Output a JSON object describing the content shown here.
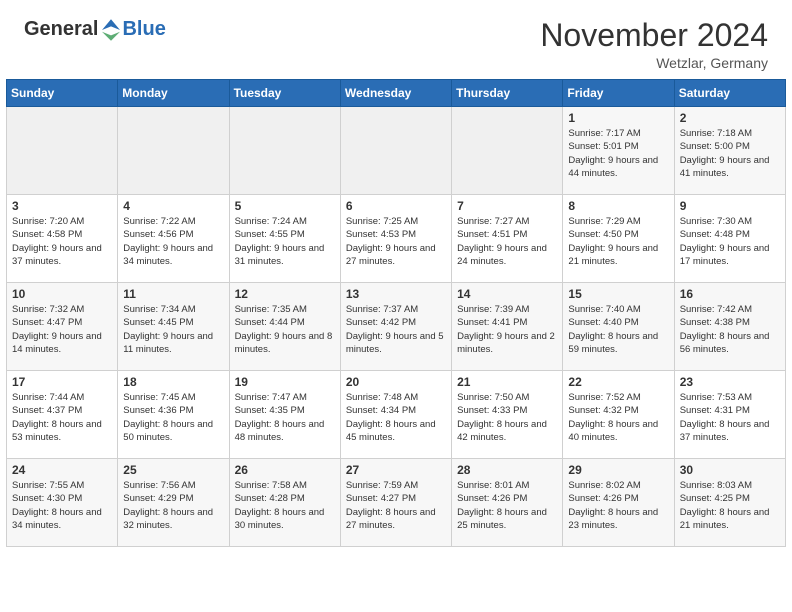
{
  "header": {
    "logo": {
      "general": "General",
      "blue": "Blue"
    },
    "title": "November 2024",
    "location": "Wetzlar, Germany"
  },
  "weekdays": [
    "Sunday",
    "Monday",
    "Tuesday",
    "Wednesday",
    "Thursday",
    "Friday",
    "Saturday"
  ],
  "weeks": [
    [
      {
        "day": "",
        "info": ""
      },
      {
        "day": "",
        "info": ""
      },
      {
        "day": "",
        "info": ""
      },
      {
        "day": "",
        "info": ""
      },
      {
        "day": "",
        "info": ""
      },
      {
        "day": "1",
        "info": "Sunrise: 7:17 AM\nSunset: 5:01 PM\nDaylight: 9 hours and 44 minutes."
      },
      {
        "day": "2",
        "info": "Sunrise: 7:18 AM\nSunset: 5:00 PM\nDaylight: 9 hours and 41 minutes."
      }
    ],
    [
      {
        "day": "3",
        "info": "Sunrise: 7:20 AM\nSunset: 4:58 PM\nDaylight: 9 hours and 37 minutes."
      },
      {
        "day": "4",
        "info": "Sunrise: 7:22 AM\nSunset: 4:56 PM\nDaylight: 9 hours and 34 minutes."
      },
      {
        "day": "5",
        "info": "Sunrise: 7:24 AM\nSunset: 4:55 PM\nDaylight: 9 hours and 31 minutes."
      },
      {
        "day": "6",
        "info": "Sunrise: 7:25 AM\nSunset: 4:53 PM\nDaylight: 9 hours and 27 minutes."
      },
      {
        "day": "7",
        "info": "Sunrise: 7:27 AM\nSunset: 4:51 PM\nDaylight: 9 hours and 24 minutes."
      },
      {
        "day": "8",
        "info": "Sunrise: 7:29 AM\nSunset: 4:50 PM\nDaylight: 9 hours and 21 minutes."
      },
      {
        "day": "9",
        "info": "Sunrise: 7:30 AM\nSunset: 4:48 PM\nDaylight: 9 hours and 17 minutes."
      }
    ],
    [
      {
        "day": "10",
        "info": "Sunrise: 7:32 AM\nSunset: 4:47 PM\nDaylight: 9 hours and 14 minutes."
      },
      {
        "day": "11",
        "info": "Sunrise: 7:34 AM\nSunset: 4:45 PM\nDaylight: 9 hours and 11 minutes."
      },
      {
        "day": "12",
        "info": "Sunrise: 7:35 AM\nSunset: 4:44 PM\nDaylight: 9 hours and 8 minutes."
      },
      {
        "day": "13",
        "info": "Sunrise: 7:37 AM\nSunset: 4:42 PM\nDaylight: 9 hours and 5 minutes."
      },
      {
        "day": "14",
        "info": "Sunrise: 7:39 AM\nSunset: 4:41 PM\nDaylight: 9 hours and 2 minutes."
      },
      {
        "day": "15",
        "info": "Sunrise: 7:40 AM\nSunset: 4:40 PM\nDaylight: 8 hours and 59 minutes."
      },
      {
        "day": "16",
        "info": "Sunrise: 7:42 AM\nSunset: 4:38 PM\nDaylight: 8 hours and 56 minutes."
      }
    ],
    [
      {
        "day": "17",
        "info": "Sunrise: 7:44 AM\nSunset: 4:37 PM\nDaylight: 8 hours and 53 minutes."
      },
      {
        "day": "18",
        "info": "Sunrise: 7:45 AM\nSunset: 4:36 PM\nDaylight: 8 hours and 50 minutes."
      },
      {
        "day": "19",
        "info": "Sunrise: 7:47 AM\nSunset: 4:35 PM\nDaylight: 8 hours and 48 minutes."
      },
      {
        "day": "20",
        "info": "Sunrise: 7:48 AM\nSunset: 4:34 PM\nDaylight: 8 hours and 45 minutes."
      },
      {
        "day": "21",
        "info": "Sunrise: 7:50 AM\nSunset: 4:33 PM\nDaylight: 8 hours and 42 minutes."
      },
      {
        "day": "22",
        "info": "Sunrise: 7:52 AM\nSunset: 4:32 PM\nDaylight: 8 hours and 40 minutes."
      },
      {
        "day": "23",
        "info": "Sunrise: 7:53 AM\nSunset: 4:31 PM\nDaylight: 8 hours and 37 minutes."
      }
    ],
    [
      {
        "day": "24",
        "info": "Sunrise: 7:55 AM\nSunset: 4:30 PM\nDaylight: 8 hours and 34 minutes."
      },
      {
        "day": "25",
        "info": "Sunrise: 7:56 AM\nSunset: 4:29 PM\nDaylight: 8 hours and 32 minutes."
      },
      {
        "day": "26",
        "info": "Sunrise: 7:58 AM\nSunset: 4:28 PM\nDaylight: 8 hours and 30 minutes."
      },
      {
        "day": "27",
        "info": "Sunrise: 7:59 AM\nSunset: 4:27 PM\nDaylight: 8 hours and 27 minutes."
      },
      {
        "day": "28",
        "info": "Sunrise: 8:01 AM\nSunset: 4:26 PM\nDaylight: 8 hours and 25 minutes."
      },
      {
        "day": "29",
        "info": "Sunrise: 8:02 AM\nSunset: 4:26 PM\nDaylight: 8 hours and 23 minutes."
      },
      {
        "day": "30",
        "info": "Sunrise: 8:03 AM\nSunset: 4:25 PM\nDaylight: 8 hours and 21 minutes."
      }
    ]
  ]
}
